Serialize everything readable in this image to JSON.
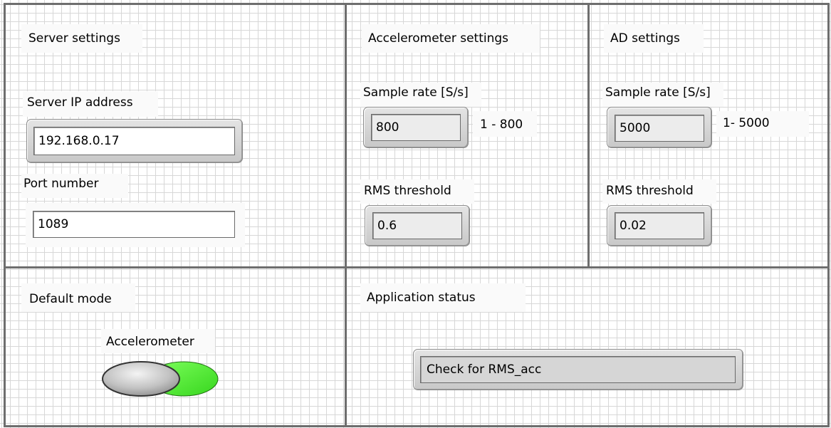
{
  "server": {
    "title": "Server settings",
    "ip_label": "Server IP address",
    "ip_value": "192.168.0.17",
    "port_label": "Port number",
    "port_value": "1089"
  },
  "accelerometer": {
    "title": "Accelerometer settings",
    "sample_rate_label": "Sample rate [S/s]",
    "sample_rate_value": "800",
    "sample_rate_range": "1 - 800",
    "rms_label": "RMS threshold",
    "rms_value": "0.6"
  },
  "ad": {
    "title": "AD settings",
    "sample_rate_label": "Sample rate [S/s]",
    "sample_rate_value": "5000",
    "sample_rate_range": "1- 5000",
    "rms_label": "RMS threshold",
    "rms_value": "0.02"
  },
  "default_mode": {
    "title": "Default mode",
    "toggle_label": "Accelerometer",
    "toggle_state": "on",
    "on_color": "#58f040"
  },
  "status": {
    "title": "Application status",
    "value": "Check for RMS_acc"
  }
}
